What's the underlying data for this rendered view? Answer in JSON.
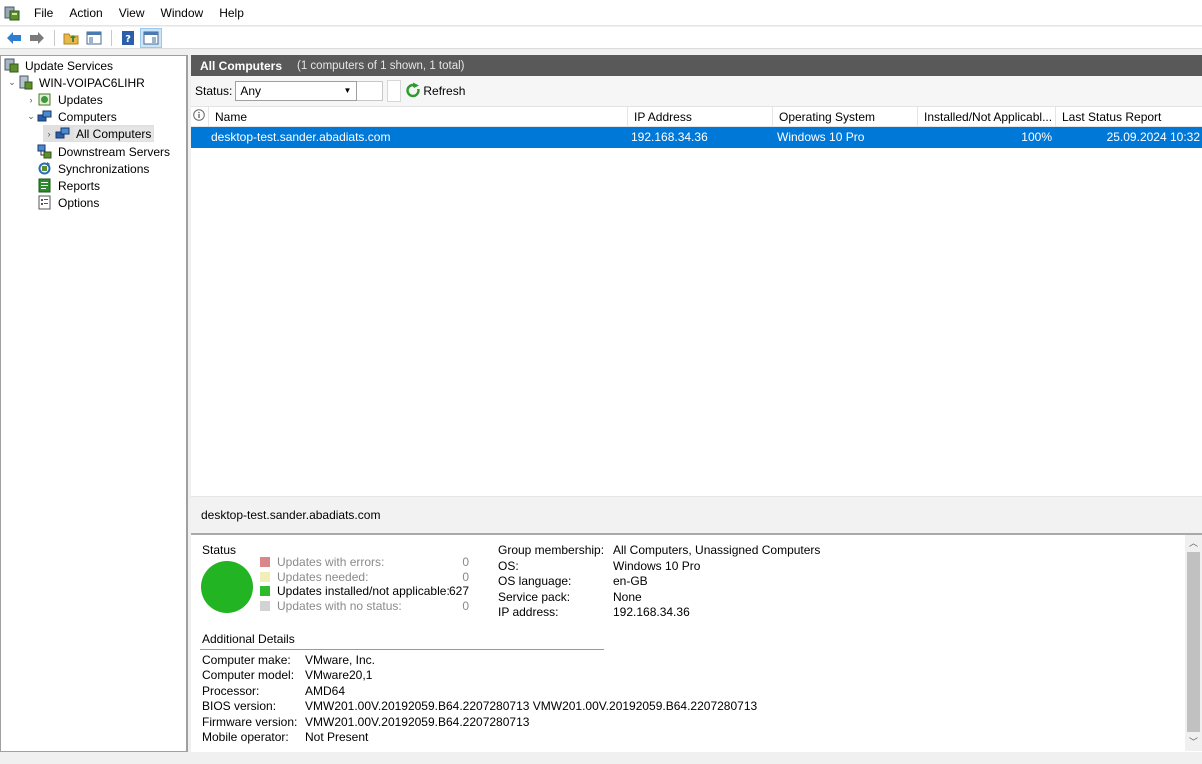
{
  "menu": [
    "File",
    "Action",
    "View",
    "Window",
    "Help"
  ],
  "tree": {
    "root": "Update Services",
    "server": "WIN-VOIPAC6LIHR",
    "updates": "Updates",
    "computers": "Computers",
    "all_computers": "All Computers",
    "downstream": "Downstream Servers",
    "sync": "Synchronizations",
    "reports": "Reports",
    "options": "Options"
  },
  "view": {
    "title": "All Computers",
    "subtitle": "(1 computers of 1 shown, 1 total)",
    "status_label": "Status:",
    "status_value": "Any",
    "refresh_label": "Refresh"
  },
  "columns": [
    "Name",
    "IP Address",
    "Operating System",
    "Installed/Not Applicabl...",
    "Last Status Report"
  ],
  "rows": [
    {
      "name": "desktop-test.sander.abadiats.com",
      "ip": "192.168.34.36",
      "os": "Windows 10 Pro",
      "installed": "100%",
      "last_report": "25.09.2024 10:32"
    }
  ],
  "details": {
    "selected_name": "desktop-test.sander.abadiats.com",
    "status_heading": "Status",
    "legend": [
      {
        "label": "Updates with errors:",
        "count": "0",
        "color": "#d9878a",
        "active": false
      },
      {
        "label": "Updates needed:",
        "count": "0",
        "color": "#f2eeb8",
        "active": false
      },
      {
        "label": "Updates installed/not applicable:",
        "count": "627",
        "color": "#2dbb2d",
        "active": true
      },
      {
        "label": "Updates with no status:",
        "count": "0",
        "color": "#d3d3d3",
        "active": false
      }
    ],
    "info": [
      {
        "label": "Group membership:",
        "value": "All Computers, Unassigned Computers"
      },
      {
        "label": "OS:",
        "value": "Windows 10 Pro"
      },
      {
        "label": "OS language:",
        "value": "en-GB"
      },
      {
        "label": "Service pack:",
        "value": "None"
      },
      {
        "label": "IP address:",
        "value": "192.168.34.36"
      }
    ],
    "additional_heading": "Additional Details",
    "additional": [
      {
        "label": "Computer make:",
        "value": "VMware, Inc."
      },
      {
        "label": "Computer model:",
        "value": "VMware20,1"
      },
      {
        "label": "Processor:",
        "value": "AMD64"
      },
      {
        "label": "BIOS version:",
        "value": "VMW201.00V.20192059.B64.2207280713 VMW201.00V.20192059.B64.2207280713"
      },
      {
        "label": "Firmware version:",
        "value": "VMW201.00V.20192059.B64.2207280713"
      },
      {
        "label": "Mobile operator:",
        "value": "Not Present"
      }
    ]
  },
  "colors": {
    "selection": "#0078d7",
    "title_bar": "#595959",
    "status_circle": "#22b422"
  }
}
